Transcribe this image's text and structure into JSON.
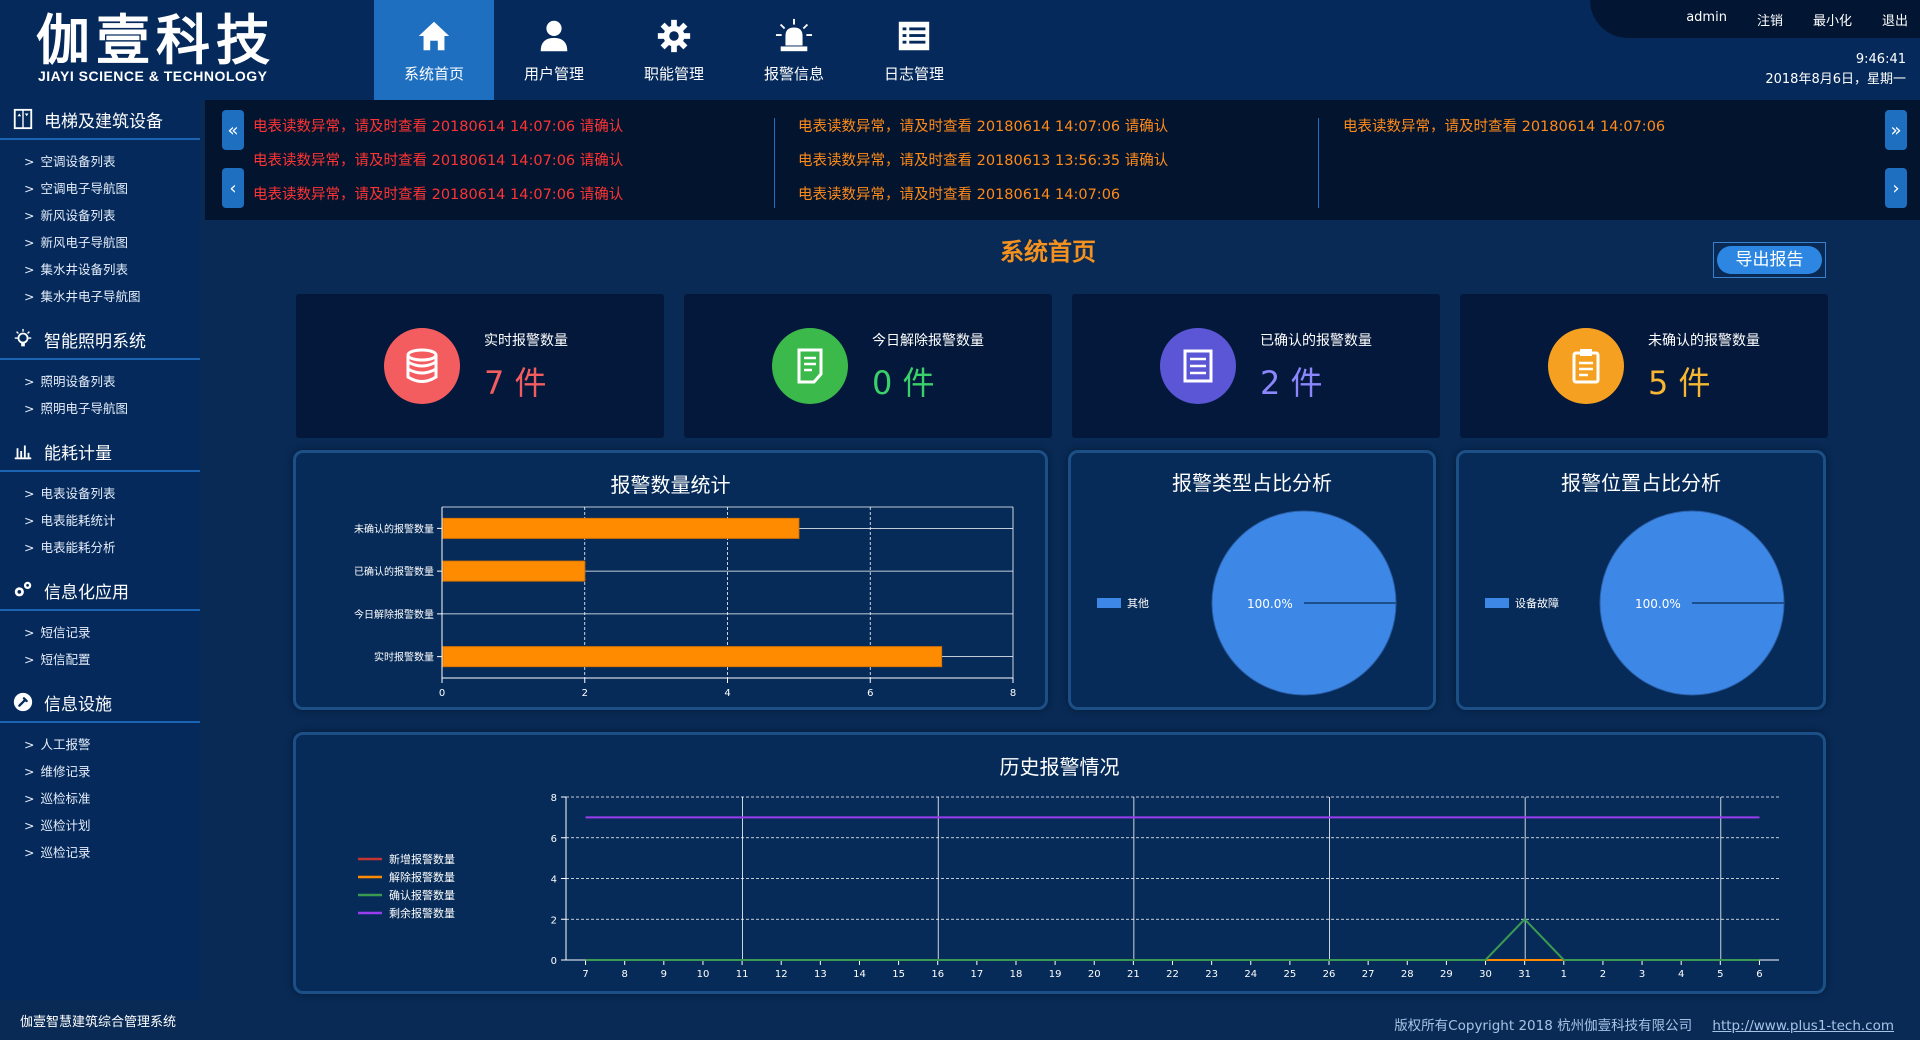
{
  "logo": {
    "cn": "伽壹科技",
    "en": "JIAYI SCIENCE & TECHNOLOGY"
  },
  "nav": [
    {
      "label": "系统首页",
      "icon": "home-icon",
      "active": true
    },
    {
      "label": "用户管理",
      "icon": "user-icon"
    },
    {
      "label": "职能管理",
      "icon": "gear-icon"
    },
    {
      "label": "报警信息",
      "icon": "alarm-siren-icon"
    },
    {
      "label": "日志管理",
      "icon": "list-icon"
    }
  ],
  "topbar": {
    "user": "admin",
    "logout": "注销",
    "minimize": "最小化",
    "exit": "退出",
    "time": "9:46:41",
    "date": "2018年8月6日，星期一"
  },
  "sidebar": [
    {
      "title": "电梯及建筑设备",
      "icon": "elevator-icon",
      "items": [
        "空调设备列表",
        "空调电子导航图",
        "新风设备列表",
        "新风电子导航图",
        "集水井设备列表",
        "集水井电子导航图"
      ]
    },
    {
      "title": "智能照明系统",
      "icon": "bulb-icon",
      "items": [
        "照明设备列表",
        "照明电子导航图"
      ]
    },
    {
      "title": "能耗计量",
      "icon": "bar-chart-icon",
      "items": [
        "电表设备列表",
        "电表能耗统计",
        "电表能耗分析"
      ]
    },
    {
      "title": "信息化应用",
      "icon": "gears-icon",
      "items": [
        "短信记录",
        "短信配置"
      ]
    },
    {
      "title": "信息设施",
      "icon": "wrench-icon",
      "items": [
        "人工报警",
        "维修记录",
        "巡检标准",
        "巡检计划",
        "巡检记录"
      ]
    }
  ],
  "ticker": {
    "col1": [
      "电表读数异常，请及时查看 20180614 14:07:06  请确认",
      "电表读数异常，请及时查看 20180614 14:07:06  请确认",
      "电表读数异常，请及时查看 20180614 14:07:06  请确认"
    ],
    "col2": [
      "电表读数异常，请及时查看 20180614 14:07:06  请确认",
      "电表读数异常，请及时查看 20180613 13:56:35  请确认",
      "电表读数异常，请及时查看 20180614 14:07:06"
    ],
    "col3": [
      "电表读数异常，请及时查看 20180614 14:07:06"
    ]
  },
  "page": {
    "title": "系统首页",
    "export_label": "导出报告"
  },
  "cards": [
    {
      "label": "实时报警数量",
      "value": "7 件",
      "color": "#f45d60",
      "value_color": "#f45d60",
      "icon": "database-icon"
    },
    {
      "label": "今日解除报警数量",
      "value": "0 件",
      "color": "#3bb94a",
      "value_color": "#3bd16a",
      "icon": "document-icon"
    },
    {
      "label": "已确认的报警数量",
      "value": "2 件",
      "color": "#5a56d6",
      "value_color": "#8c86ff",
      "icon": "list-doc-icon"
    },
    {
      "label": "未确认的报警数量",
      "value": "5 件",
      "color": "#f6a021",
      "value_color": "#f7b733",
      "icon": "clipboard-icon"
    }
  ],
  "footer": {
    "left": "伽壹智慧建筑综合管理系统",
    "copyright": "版权所有Copyright 2018 杭州伽壹科技有限公司",
    "url": "http://www.plus1-tech.com"
  },
  "chart_data": [
    {
      "type": "bar",
      "orientation": "horizontal",
      "title": "报警数量统计",
      "categories": [
        "未确认的报警数量",
        "已确认的报警数量",
        "今日解除报警数量",
        "实时报警数量"
      ],
      "values": [
        5,
        2,
        0,
        7
      ],
      "xlim": [
        0,
        8
      ],
      "xticks": [
        0,
        2,
        4,
        6,
        8
      ],
      "color": "#ff8c00"
    },
    {
      "type": "pie",
      "title": "报警类型占比分析",
      "slices": [
        {
          "name": "其他",
          "value": 100.0,
          "label": "100.0%"
        }
      ],
      "color": "#3d87e6",
      "legend": "left"
    },
    {
      "type": "pie",
      "title": "报警位置占比分析",
      "slices": [
        {
          "name": "设备故障",
          "value": 100.0,
          "label": "100.0%"
        }
      ],
      "color": "#3d87e6",
      "legend": "left"
    },
    {
      "type": "line",
      "title": "历史报警情况",
      "x": [
        "7",
        "8",
        "9",
        "10",
        "11",
        "12",
        "13",
        "14",
        "15",
        "16",
        "17",
        "18",
        "19",
        "20",
        "21",
        "22",
        "23",
        "24",
        "25",
        "26",
        "27",
        "28",
        "29",
        "30",
        "31",
        "1",
        "2",
        "3",
        "4",
        "5",
        "6"
      ],
      "ylim": [
        0,
        8
      ],
      "yticks": [
        0,
        2,
        4,
        6,
        8
      ],
      "legend": "left",
      "series": [
        {
          "name": "新增报警数量",
          "color": "#c23531",
          "values": [
            0,
            0,
            0,
            0,
            0,
            0,
            0,
            0,
            0,
            0,
            0,
            0,
            0,
            0,
            0,
            0,
            0,
            0,
            0,
            0,
            0,
            0,
            0,
            0,
            0,
            0,
            0,
            0,
            0,
            0,
            0
          ]
        },
        {
          "name": "解除报警数量",
          "color": "#ff8c00",
          "values": [
            0,
            0,
            0,
            0,
            0,
            0,
            0,
            0,
            0,
            0,
            0,
            0,
            0,
            0,
            0,
            0,
            0,
            0,
            0,
            0,
            0,
            0,
            0,
            0,
            0,
            0,
            0,
            0,
            0,
            0,
            0
          ]
        },
        {
          "name": "确认报警数量",
          "color": "#3a9a52",
          "values": [
            0,
            0,
            0,
            0,
            0,
            0,
            0,
            0,
            0,
            0,
            0,
            0,
            0,
            0,
            0,
            0,
            0,
            0,
            0,
            0,
            0,
            0,
            0,
            0,
            2,
            0,
            0,
            0,
            0,
            0,
            0
          ]
        },
        {
          "name": "剩余报警数量",
          "color": "#9a3cf0",
          "values": [
            7,
            7,
            7,
            7,
            7,
            7,
            7,
            7,
            7,
            7,
            7,
            7,
            7,
            7,
            7,
            7,
            7,
            7,
            7,
            7,
            7,
            7,
            7,
            7,
            7,
            7,
            7,
            7,
            7,
            7,
            7
          ]
        }
      ]
    }
  ]
}
